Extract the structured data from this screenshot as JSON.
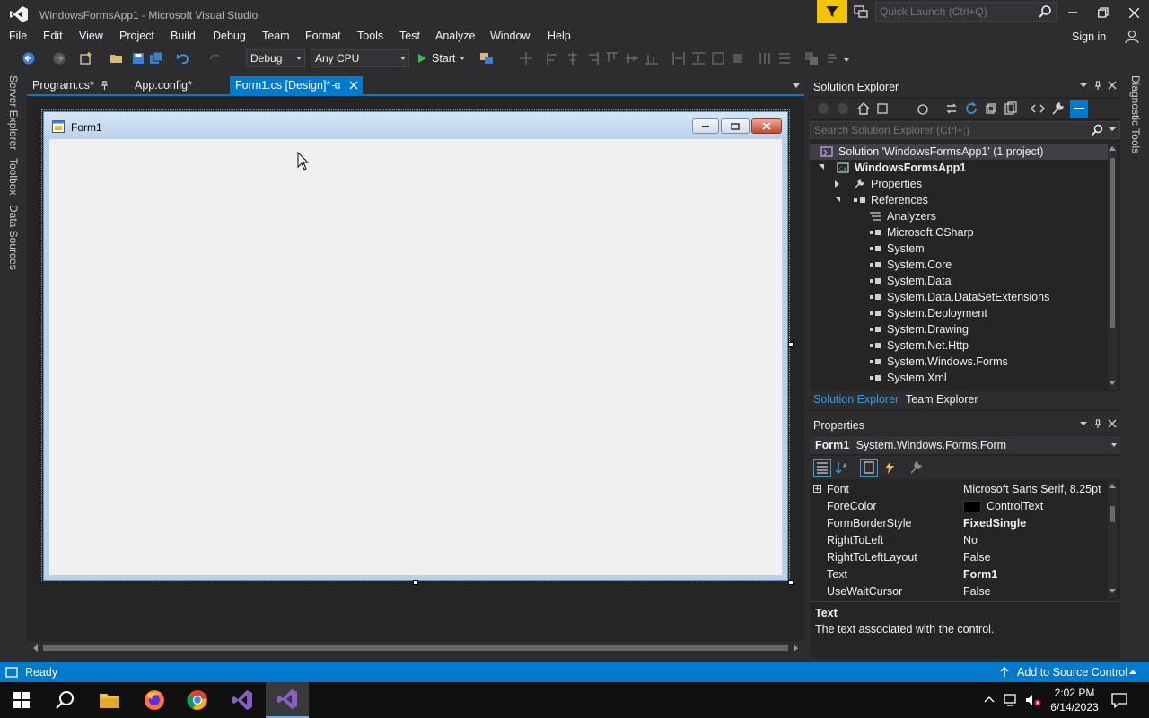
{
  "window": {
    "title": "WindowsFormsApp1 - Microsoft Visual Studio",
    "quick_launch_placeholder": "Quick Launch (Ctrl+Q)"
  },
  "menu": [
    "File",
    "Edit",
    "View",
    "Project",
    "Build",
    "Debug",
    "Team",
    "Format",
    "Tools",
    "Test",
    "Analyze",
    "Window",
    "Help"
  ],
  "signin_label": "Sign in",
  "toolbar": {
    "config": "Debug",
    "platform": "Any CPU",
    "start_label": "Start"
  },
  "side_tabs_left": [
    "Server Explorer",
    "Toolbox",
    "Data Sources"
  ],
  "side_tabs_right": [
    "Diagnostic Tools"
  ],
  "doc_tabs": [
    {
      "label": "Program.cs*"
    },
    {
      "label": "App.config*"
    },
    {
      "label": "Form1.cs [Design]*"
    }
  ],
  "designer": {
    "form_caption": "Form1"
  },
  "solution_explorer": {
    "title": "Solution Explorer",
    "search_placeholder": "Search Solution Explorer (Ctrl+;)",
    "items": [
      {
        "label": "Solution 'WindowsFormsApp1' (1 project)"
      },
      {
        "label": "WindowsFormsApp1"
      },
      {
        "label": "Properties"
      },
      {
        "label": "References"
      },
      {
        "label": "Analyzers"
      },
      {
        "label": "Microsoft.CSharp"
      },
      {
        "label": "System"
      },
      {
        "label": "System.Core"
      },
      {
        "label": "System.Data"
      },
      {
        "label": "System.Data.DataSetExtensions"
      },
      {
        "label": "System.Deployment"
      },
      {
        "label": "System.Drawing"
      },
      {
        "label": "System.Net.Http"
      },
      {
        "label": "System.Windows.Forms"
      },
      {
        "label": "System.Xml"
      }
    ],
    "bottom_tabs": [
      "Solution Explorer",
      "Team Explorer"
    ]
  },
  "properties": {
    "title": "Properties",
    "object_name": "Form1",
    "object_type": "System.Windows.Forms.Form",
    "rows": [
      {
        "name": "Font",
        "value": "Microsoft Sans Serif, 8.25pt"
      },
      {
        "name": "ForeColor",
        "value": "ControlText"
      },
      {
        "name": "FormBorderStyle",
        "value": "FixedSingle"
      },
      {
        "name": "RightToLeft",
        "value": "No"
      },
      {
        "name": "RightToLeftLayout",
        "value": "False"
      },
      {
        "name": "Text",
        "value": "Form1"
      },
      {
        "name": "UseWaitCursor",
        "value": "False"
      }
    ],
    "desc_title": "Text",
    "desc_body": "The text associated with the control."
  },
  "status": {
    "left": "Ready",
    "right": "Add to Source Control"
  },
  "taskbar": {
    "time": "2:02 PM",
    "date": "6/14/2023"
  },
  "colors": {
    "accent": "#007acc",
    "bg": "#2d2d30",
    "filter": "#f5c400"
  }
}
